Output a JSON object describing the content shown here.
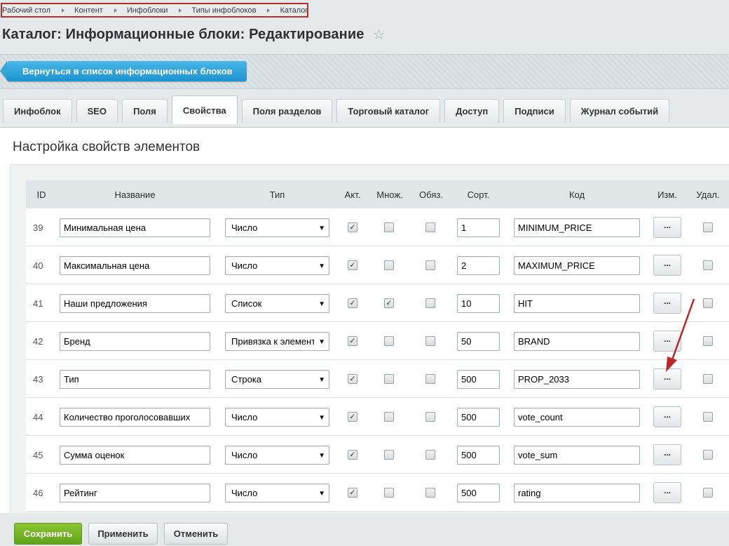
{
  "breadcrumb": [
    "Рабочий стол",
    "Контент",
    "Инфоблоки",
    "Типы инфоблоков",
    "Каталог"
  ],
  "page_title": "Каталог: Информационные блоки: Редактирование",
  "back_button": "Вернуться в список информационных блоков",
  "tabs": [
    {
      "label": "Инфоблок",
      "active": false
    },
    {
      "label": "SEO",
      "active": false
    },
    {
      "label": "Поля",
      "active": false
    },
    {
      "label": "Свойства",
      "active": true
    },
    {
      "label": "Поля разделов",
      "active": false
    },
    {
      "label": "Торговый каталог",
      "active": false
    },
    {
      "label": "Доступ",
      "active": false
    },
    {
      "label": "Подписи",
      "active": false
    },
    {
      "label": "Журнал событий",
      "active": false
    }
  ],
  "section_title": "Настройка свойств элементов",
  "table": {
    "headers": {
      "id": "ID",
      "name": "Название",
      "type": "Тип",
      "active": "Акт.",
      "multiple": "Множ.",
      "required": "Обяз.",
      "sort": "Сорт.",
      "code": "Код",
      "edit": "Изм.",
      "delete": "Удал."
    },
    "edit_label": "...",
    "rows": [
      {
        "id": "39",
        "name": "Минимальная цена",
        "type": "Число",
        "active": true,
        "multiple": false,
        "required": false,
        "sort": "1",
        "code": "MINIMUM_PRICE",
        "delete": false
      },
      {
        "id": "40",
        "name": "Максимальная цена",
        "type": "Число",
        "active": true,
        "multiple": false,
        "required": false,
        "sort": "2",
        "code": "MAXIMUM_PRICE",
        "delete": false
      },
      {
        "id": "41",
        "name": "Наши предложения",
        "type": "Список",
        "active": true,
        "multiple": true,
        "required": false,
        "sort": "10",
        "code": "HIT",
        "delete": false
      },
      {
        "id": "42",
        "name": "Бренд",
        "type": "Привязка к элементам",
        "active": true,
        "multiple": false,
        "required": false,
        "sort": "50",
        "code": "BRAND",
        "delete": false
      },
      {
        "id": "43",
        "name": "Тип",
        "type": "Строка",
        "active": true,
        "multiple": false,
        "required": false,
        "sort": "500",
        "code": "PROP_2033",
        "delete": false
      },
      {
        "id": "44",
        "name": "Количество проголосовавших",
        "type": "Число",
        "active": true,
        "multiple": false,
        "required": false,
        "sort": "500",
        "code": "vote_count",
        "delete": false
      },
      {
        "id": "45",
        "name": "Сумма оценок",
        "type": "Число",
        "active": true,
        "multiple": false,
        "required": false,
        "sort": "500",
        "code": "vote_sum",
        "delete": false
      },
      {
        "id": "46",
        "name": "Рейтинг",
        "type": "Число",
        "active": true,
        "multiple": false,
        "required": false,
        "sort": "500",
        "code": "rating",
        "delete": false
      }
    ]
  },
  "footer": {
    "save": "Сохранить",
    "apply": "Применить",
    "cancel": "Отменить"
  },
  "colors": {
    "accent_blue": "#1d93cf",
    "save_green": "#6cb01f",
    "annotation_red": "#c0272d"
  }
}
